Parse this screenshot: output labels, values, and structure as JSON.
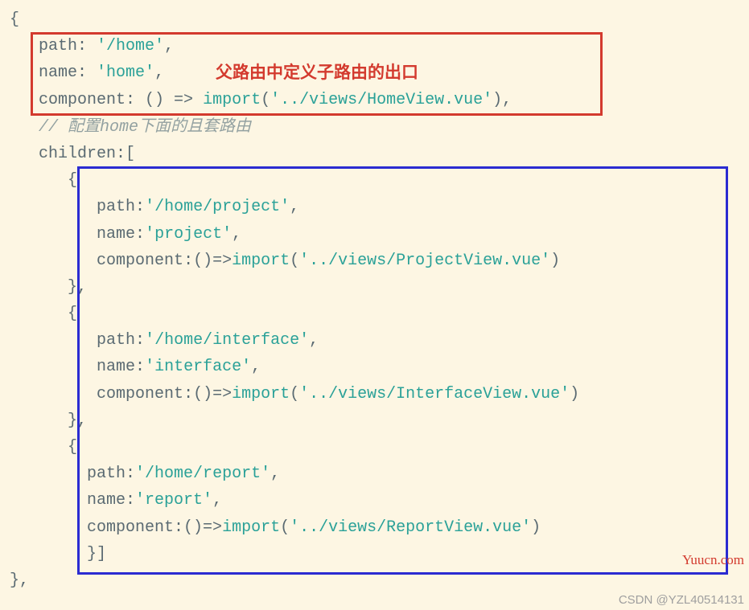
{
  "annotation_label": "父路由中定义子路由的出口",
  "comment_prefix": "// ",
  "comment_text_prefix": "配置",
  "comment_text_mid": "home",
  "comment_text_suffix": "下面的且套路由",
  "watermark_site": "Yuucn.com",
  "watermark_csdn": "CSDN @YZL40514131",
  "code": {
    "open_brace": "{",
    "path_key": "path",
    "path_val": "'/home'",
    "name_key": "name",
    "name_val": "'home'",
    "component_key": "component",
    "arrow1": ": () => ",
    "import_kw": "import",
    "home_import": "'../views/HomeView.vue'",
    "children_key": "children",
    "children_open": ":[",
    "child1_path": "'/home/project'",
    "child1_name": "'project'",
    "child1_import": "'../views/ProjectView.vue'",
    "child2_path": "'/home/interface'",
    "child2_name": "'interface'",
    "child2_import": "'../views/InterfaceView.vue'",
    "child3_path": "'/home/report'",
    "child3_name": "'report'",
    "child3_import": "'../views/ReportView.vue'",
    "close_child": "}]",
    "close_brace": "},"
  }
}
